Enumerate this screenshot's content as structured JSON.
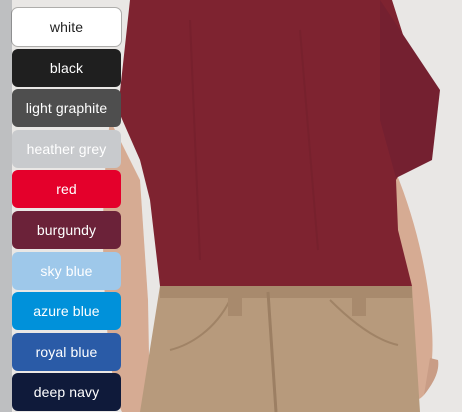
{
  "photo": {
    "background": "#e9e7e5",
    "shirt_color": "#7e2330",
    "pants_color": "#b79a7c",
    "skin_color": "#d6ab93"
  },
  "swatches": [
    {
      "label": "white",
      "bg": "#ffffff",
      "fg": "#222222"
    },
    {
      "label": "black",
      "bg": "#1f1f1f",
      "fg": "#ffffff"
    },
    {
      "label": "light graphite",
      "bg": "#4e4e4e",
      "fg": "#ffffff"
    },
    {
      "label": "heather grey",
      "bg": "#c8cacd",
      "fg": "#ffffff"
    },
    {
      "label": "red",
      "bg": "#e4002b",
      "fg": "#ffffff"
    },
    {
      "label": "burgundy",
      "bg": "#6b2239",
      "fg": "#ffffff"
    },
    {
      "label": "sky blue",
      "bg": "#9ec8ea",
      "fg": "#ffffff"
    },
    {
      "label": "azure blue",
      "bg": "#0091da",
      "fg": "#ffffff"
    },
    {
      "label": "royal blue",
      "bg": "#2a5ba7",
      "fg": "#ffffff"
    },
    {
      "label": "deep navy",
      "bg": "#0f1a3a",
      "fg": "#ffffff"
    }
  ]
}
